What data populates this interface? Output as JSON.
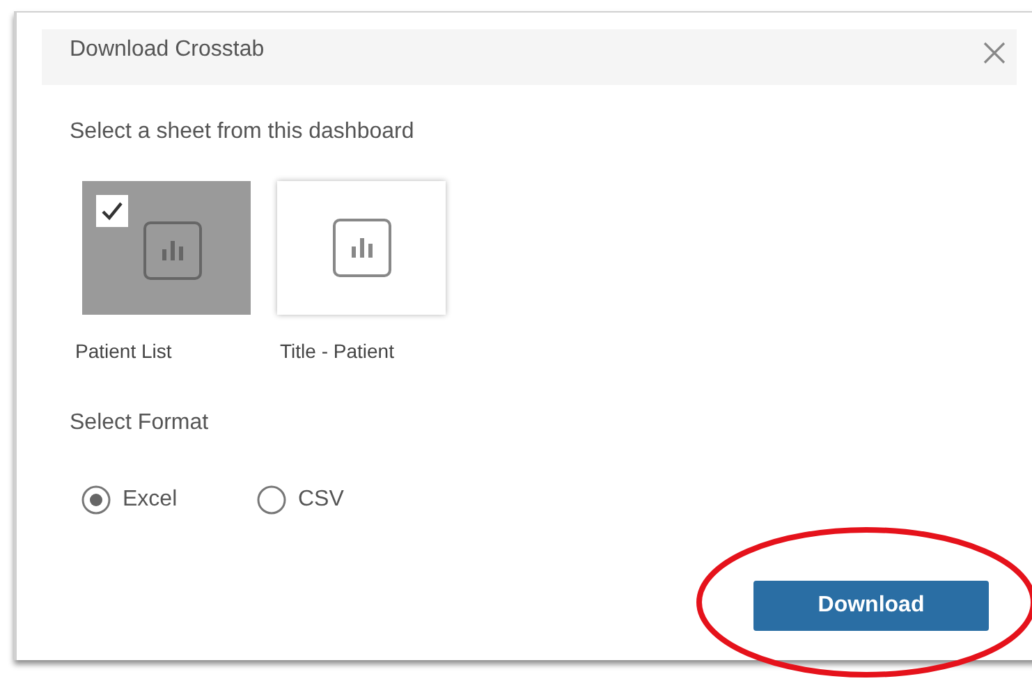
{
  "dialog": {
    "title": "Download Crosstab",
    "prompt": "Select a sheet from this dashboard",
    "sheets": [
      {
        "label": "Patient List",
        "selected": true
      },
      {
        "label": "Title - Patient",
        "selected": false
      }
    ],
    "format_label": "Select Format",
    "formats": [
      {
        "label": "Excel",
        "selected": true
      },
      {
        "label": "CSV",
        "selected": false
      }
    ],
    "button": "Download"
  }
}
